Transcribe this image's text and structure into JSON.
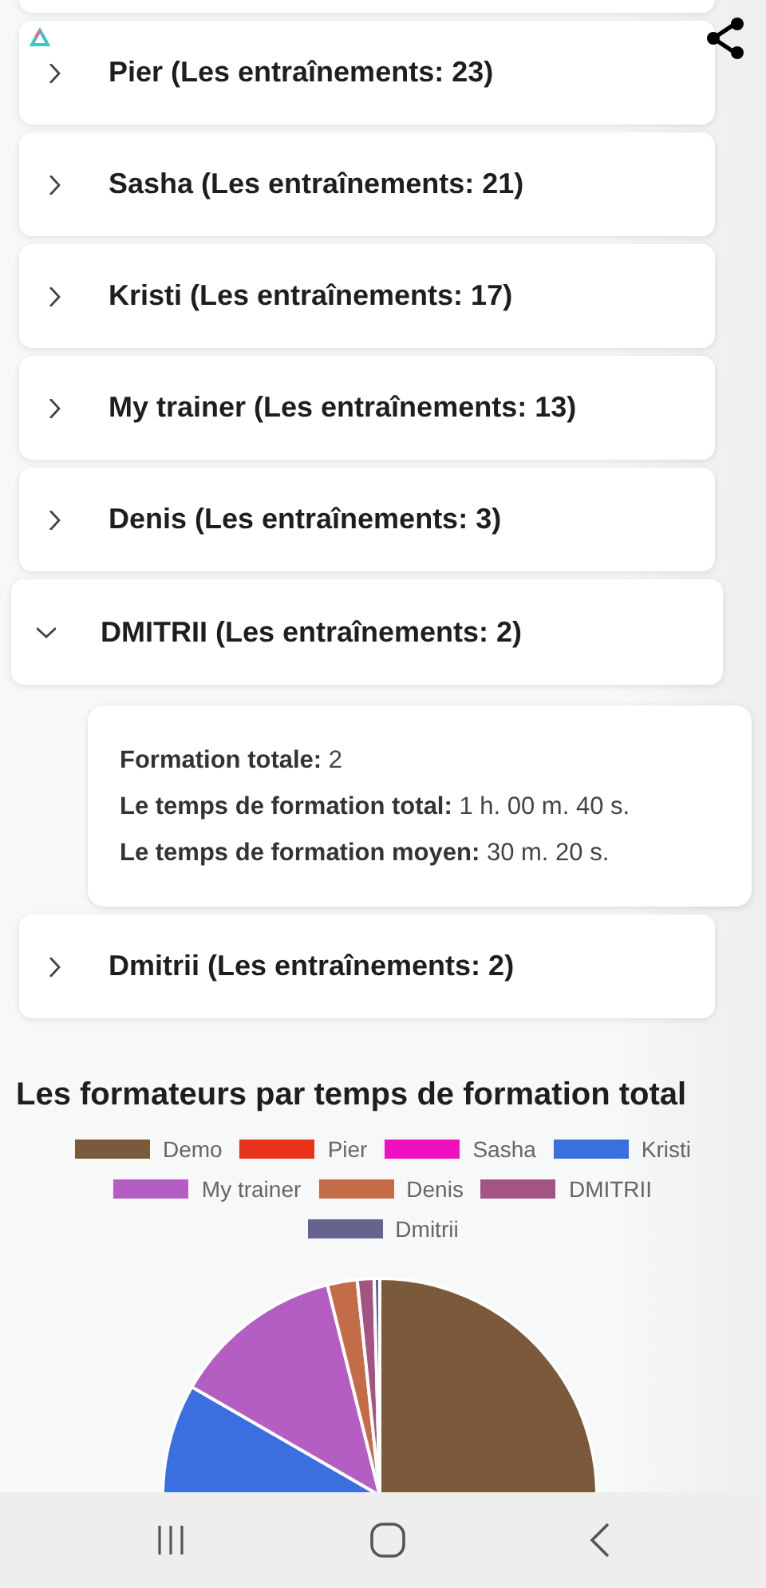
{
  "trainers": [
    {
      "expanded": false
    },
    {
      "label": "Pier (Les entraînements: 23)",
      "expanded": false
    },
    {
      "label": "Sasha (Les entraînements: 21)",
      "expanded": false
    },
    {
      "label": "Kristi (Les entraînements: 17)",
      "expanded": false
    },
    {
      "label": "My trainer (Les entraînements: 13)",
      "expanded": false
    },
    {
      "label": "Denis (Les entraînements: 3)",
      "expanded": false
    },
    {
      "label": "DMITRII (Les entraînements: 2)",
      "expanded": true,
      "details": [
        "**Formation totale:** 2",
        "**Le temps de formation total:** 1 h. 00 m. 40 s.",
        "**Le temps de formation moyen:** 30 m. 20 s."
      ]
    },
    {
      "label": "Dmitrii (Les entraînements: 2)",
      "expanded": false
    }
  ],
  "chart": {
    "title": "Les formateurs par temps de formation total",
    "legend": [
      {
        "label": "Demo",
        "color": "#7a5a3a"
      },
      {
        "label": "Pier",
        "color": "#e8321a"
      },
      {
        "label": "Sasha",
        "color": "#f010c0"
      },
      {
        "label": "Kristi",
        "color": "#3a6fe0"
      },
      {
        "label": "My trainer",
        "color": "#b45ec4"
      },
      {
        "label": "Denis",
        "color": "#c46c48"
      },
      {
        "label": "DMITRII",
        "color": "#a45482"
      },
      {
        "label": "Dmitrii",
        "color": "#66648e"
      }
    ]
  }
}
